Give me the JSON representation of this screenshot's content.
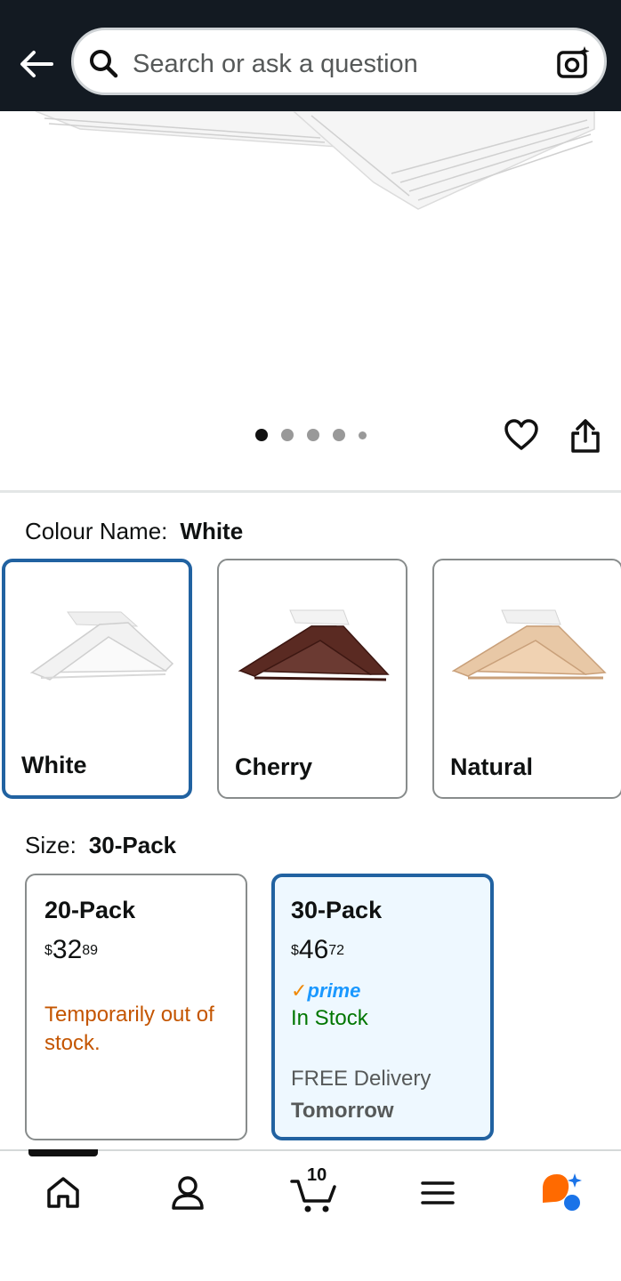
{
  "search": {
    "placeholder": "Search or ask a question"
  },
  "gallery": {
    "dot_count": 5,
    "active_index": 0
  },
  "colour": {
    "label": "Colour Name:",
    "selected": "White",
    "options": [
      {
        "label": "White",
        "color": "#f4f4f4"
      },
      {
        "label": "Cherry",
        "color": "#5a2a22"
      },
      {
        "label": "Natural",
        "color": "#e8c8a6"
      }
    ]
  },
  "size": {
    "label": "Size:",
    "selected": "30-Pack",
    "options": [
      {
        "name": "20-Pack",
        "currency": "$",
        "price_whole": "32",
        "price_fraction": "89",
        "status": "Temporarily out of stock."
      },
      {
        "name": "30-Pack",
        "currency": "$",
        "price_whole": "46",
        "price_fraction": "72",
        "prime": "prime",
        "status": "In Stock",
        "delivery_label": "FREE Delivery",
        "delivery_day": "Tomorrow"
      }
    ]
  },
  "nav": {
    "cart_count": "10"
  },
  "colors": {
    "header_bg": "#131a22",
    "selection_border": "#2162a1",
    "in_stock": "#007600",
    "out_of_stock": "#c45500",
    "prime_blue": "#1a98ff",
    "rufus_orange": "#ff6a00"
  }
}
